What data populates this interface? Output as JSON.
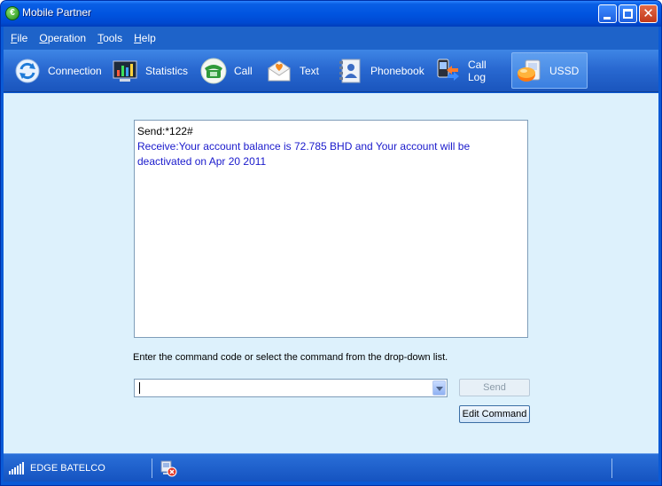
{
  "window": {
    "title": "Mobile Partner",
    "app_icon_glyph": "€",
    "controls": [
      "minimize-icon",
      "maximize-icon",
      "close-icon"
    ],
    "close_glyph": "✕"
  },
  "menu": [
    {
      "label_underlined": "F",
      "label_rest": "ile"
    },
    {
      "label_underlined": "O",
      "label_rest": "peration"
    },
    {
      "label_underlined": "T",
      "label_rest": "ools"
    },
    {
      "label_underlined": "H",
      "label_rest": "elp"
    }
  ],
  "toolbar": {
    "items": [
      {
        "label": "Connection",
        "icon": "connection-icon"
      },
      {
        "label": "Statistics",
        "icon": "statistics-icon"
      },
      {
        "label": "Call",
        "icon": "phone-icon"
      },
      {
        "label": "Text",
        "icon": "envelope-icon"
      },
      {
        "label": "Phonebook",
        "icon": "phonebook-icon"
      },
      {
        "label": "Call Log",
        "icon": "call-log-icon"
      },
      {
        "label": "USSD",
        "icon": "ussd-icon",
        "active": true
      }
    ]
  },
  "ussd": {
    "log_send": "Send:*122#",
    "log_receive_line1": "Receive:Your account balance is 72.785 BHD and Your account will be",
    "log_receive_line2": "deactivated on Apr 20 2011",
    "hint": "Enter the command code or select the command from the drop-down list.",
    "command_value": "",
    "send_label": "Send",
    "edit_label": "Edit Command"
  },
  "status": {
    "network": "EDGE BATELCO",
    "signal_icon": "signal-strength-icon",
    "connection_icon": "disconnected-icon"
  },
  "colors": {
    "window_frame": "#0a5ad6",
    "content_bg": "#ddf1fc",
    "receive_text": "#1a1acc"
  }
}
